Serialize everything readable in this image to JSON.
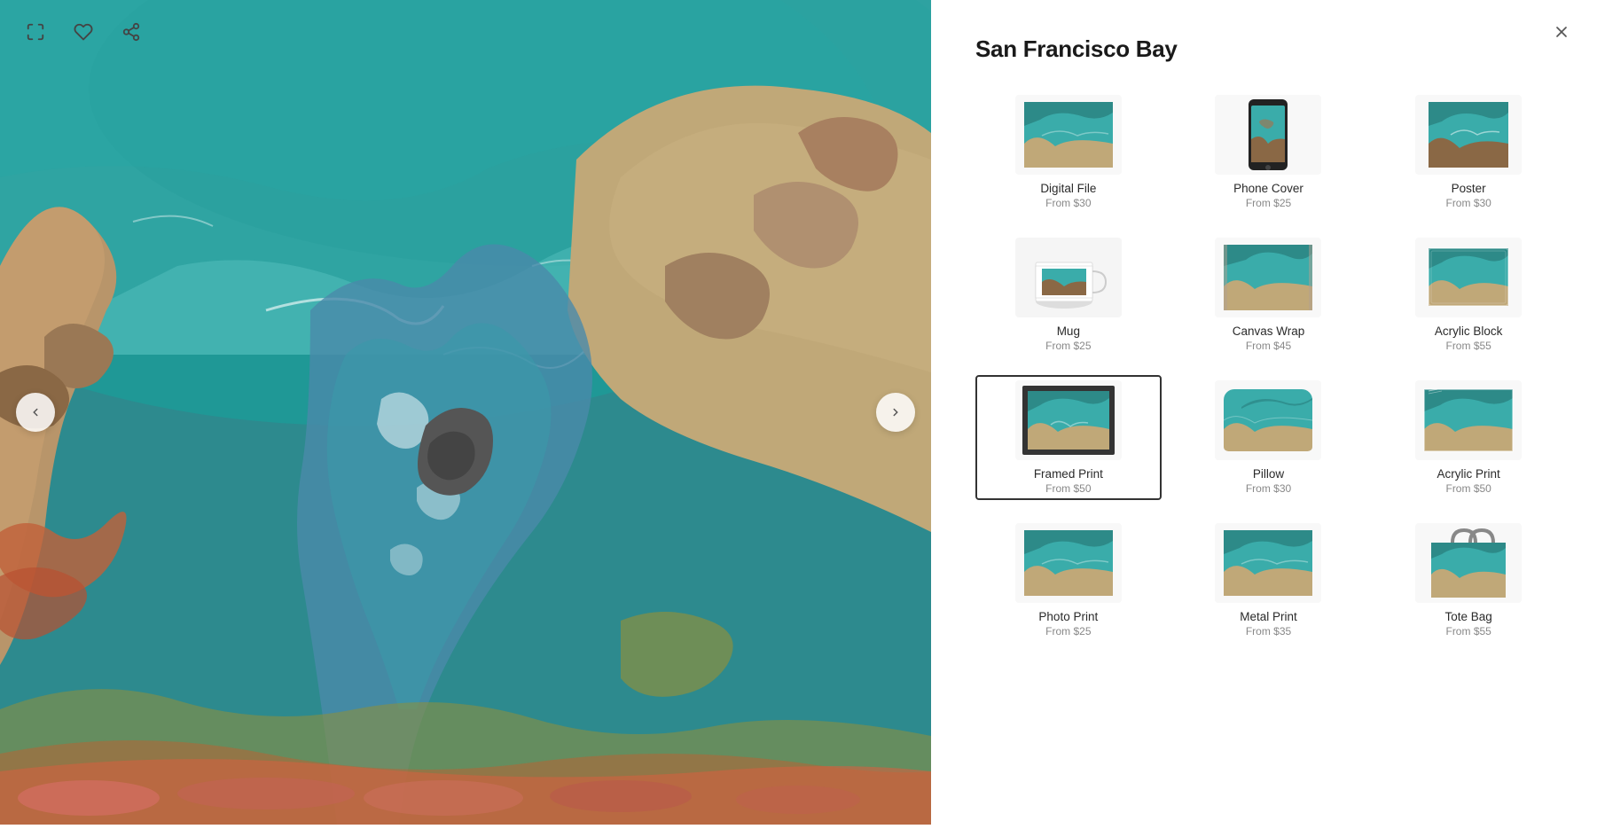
{
  "artwork": {
    "title": "San Francisco Bay"
  },
  "controls": {
    "expand_label": "expand",
    "like_label": "like",
    "share_label": "share",
    "close_label": "close"
  },
  "products": [
    {
      "id": "digital-file",
      "name": "Digital File",
      "price": "From $30",
      "selected": false,
      "type": "flat"
    },
    {
      "id": "phone-cover",
      "name": "Phone Cover",
      "price": "From $25",
      "selected": false,
      "type": "phone"
    },
    {
      "id": "poster",
      "name": "Poster",
      "price": "From $30",
      "selected": false,
      "type": "poster"
    },
    {
      "id": "mug",
      "name": "Mug",
      "price": "From $25",
      "selected": false,
      "type": "mug"
    },
    {
      "id": "canvas-wrap",
      "name": "Canvas Wrap",
      "price": "From $45",
      "selected": false,
      "type": "canvas"
    },
    {
      "id": "acrylic-block",
      "name": "Acrylic Block",
      "price": "From $55",
      "selected": false,
      "type": "block"
    },
    {
      "id": "framed-print",
      "name": "Framed Print",
      "price": "From $50",
      "selected": true,
      "type": "framed"
    },
    {
      "id": "pillow",
      "name": "Pillow",
      "price": "From $30",
      "selected": false,
      "type": "pillow"
    },
    {
      "id": "acrylic-print",
      "name": "Acrylic Print",
      "price": "From $50",
      "selected": false,
      "type": "acrylic"
    },
    {
      "id": "photo-print",
      "name": "Photo Print",
      "price": "From $25",
      "selected": false,
      "type": "flat"
    },
    {
      "id": "metal-print",
      "name": "Metal Print",
      "price": "From $35",
      "selected": false,
      "type": "flat"
    },
    {
      "id": "tote-bag",
      "name": "Tote Bag",
      "price": "From $55",
      "selected": false,
      "type": "tote"
    }
  ]
}
